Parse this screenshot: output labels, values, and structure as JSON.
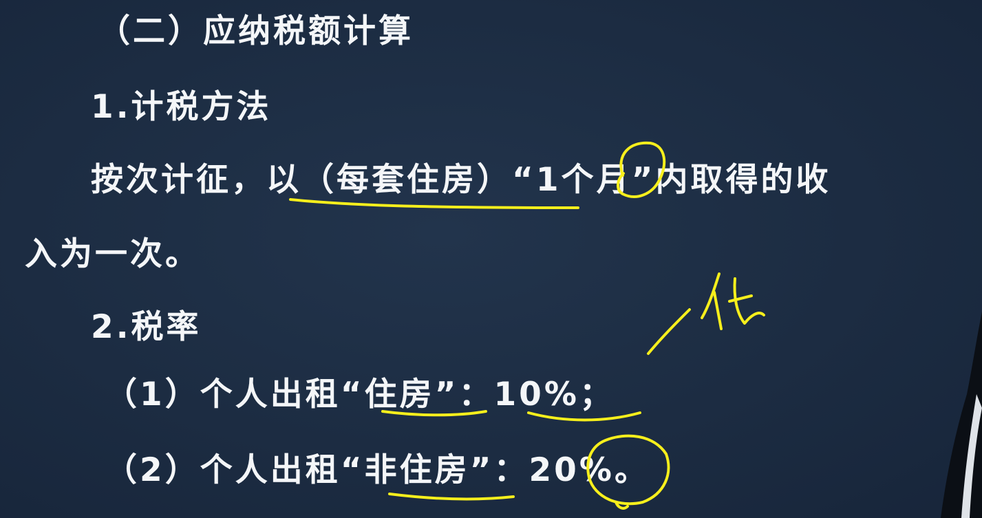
{
  "slide": {
    "heading": "（二）应纳税额计算",
    "method_title": "1.计税方法",
    "method_body_line1": "按次计征，以（每套住房）“1个月”内取得的收",
    "method_body_line2": "入为一次。",
    "rate_title": "2.税率",
    "rate_item_1": "（1）个人出租“住房”：10%；",
    "rate_item_2": "（2）个人出租“非住房”：20%。"
  },
  "colors": {
    "background": "#1c2c42",
    "text": "#f4f6f8",
    "annotation_ink": "#f7ef1c"
  }
}
